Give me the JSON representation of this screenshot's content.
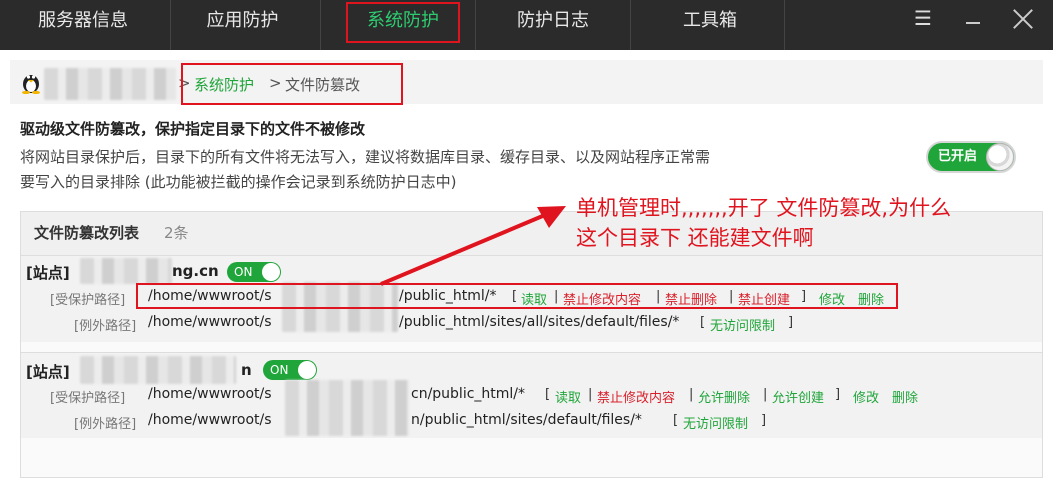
{
  "nav": {
    "items": [
      {
        "label": "服务器信息"
      },
      {
        "label": "应用防护"
      },
      {
        "label": "系统防护"
      },
      {
        "label": "防护日志"
      },
      {
        "label": "工具箱"
      }
    ],
    "menu_glyph": "☰"
  },
  "breadcrumb": {
    "sep1": ">",
    "section": "系统防护",
    "sep2": ">",
    "current": "文件防篡改"
  },
  "feature": {
    "heading": "驱动级文件防篡改，保护指定目录下的文件不被修改",
    "desc_line1": "将网站目录保护后，目录下的所有文件将无法写入，建议将数据库目录、缓存目录、以及网站程序正常需",
    "desc_line2": "要写入的目录排除 (此功能被拦截的操作会记录到系统防护日志中)",
    "toggle_label": "已开启"
  },
  "annotation": {
    "line1": "单机管理时,,,,,,,开了 文件防篡改,为什么",
    "line2": "这个目录下 还能建文件啊"
  },
  "list": {
    "title": "文件防篡改列表",
    "count": "2条",
    "sites": [
      {
        "label": "[站点]",
        "name_suffix": "ng.cn",
        "on": "ON",
        "protected_label": "[受保护路径]",
        "protected_prefix": "/home/wwwroot/s",
        "protected_suffix": "/public_html/*",
        "perms": [
          {
            "text": "读取",
            "color": "green"
          },
          {
            "text": "禁止修改内容",
            "color": "red"
          },
          {
            "text": "禁止删除",
            "color": "red"
          },
          {
            "text": "禁止创建",
            "color": "red"
          }
        ],
        "edit": "修改",
        "delete": "删除",
        "except_label": "[例外路径]",
        "except_prefix": "/home/wwwroot/s",
        "except_suffix": "/public_html/sites/all/sites/default/files/*",
        "except_tag": "无访问限制"
      },
      {
        "label": "[站点]",
        "name_suffix": "n",
        "on": "ON",
        "protected_label": "[受保护路径]",
        "protected_prefix": "/home/wwwroot/s",
        "protected_suffix": "cn/public_html/*",
        "perms": [
          {
            "text": "读取",
            "color": "green"
          },
          {
            "text": "禁止修改内容",
            "color": "red"
          },
          {
            "text": "允许删除",
            "color": "green"
          },
          {
            "text": "允许创建",
            "color": "green"
          }
        ],
        "edit": "修改",
        "delete": "删除",
        "except_label": "[例外路径]",
        "except_prefix": "/home/wwwroot/s",
        "except_suffix": "n/public_html/sites/default/files/*",
        "except_tag": "无访问限制"
      }
    ]
  }
}
